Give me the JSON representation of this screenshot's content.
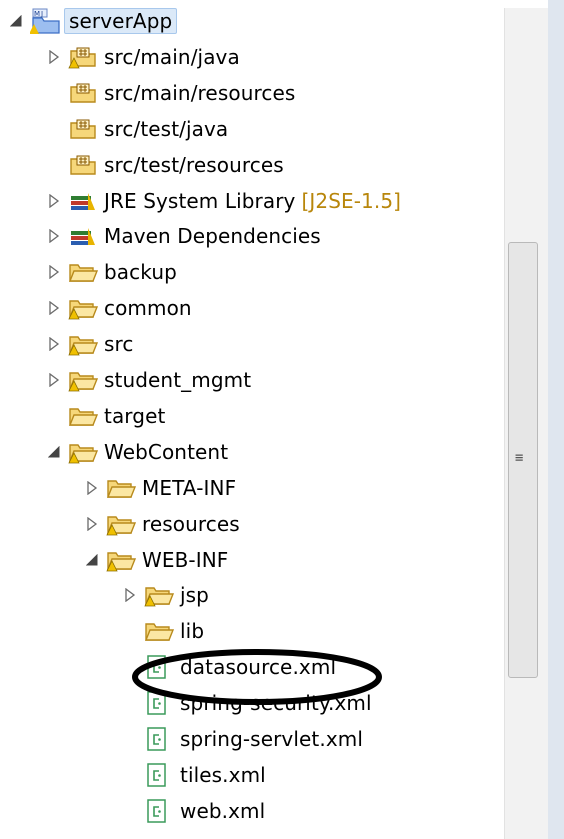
{
  "tree": {
    "rows": [
      {
        "label": "serverApp",
        "indent": 0,
        "arrow": "expanded",
        "icon": "project-icon",
        "selected": true
      },
      {
        "label": "src/main/java",
        "indent": 1,
        "arrow": "collapsed",
        "icon": "source-folder-warning-icon"
      },
      {
        "label": "src/main/resources",
        "indent": 1,
        "arrow": "none",
        "icon": "source-folder-icon"
      },
      {
        "label": "src/test/java",
        "indent": 1,
        "arrow": "none",
        "icon": "source-folder-icon"
      },
      {
        "label": "src/test/resources",
        "indent": 1,
        "arrow": "none",
        "icon": "source-folder-icon"
      },
      {
        "label": "JRE System Library",
        "decoration": "[J2SE-1.5]",
        "indent": 1,
        "arrow": "collapsed",
        "icon": "library-icon"
      },
      {
        "label": "Maven Dependencies",
        "indent": 1,
        "arrow": "collapsed",
        "icon": "library-icon"
      },
      {
        "label": "backup",
        "indent": 1,
        "arrow": "collapsed",
        "icon": "folder-icon"
      },
      {
        "label": "common",
        "indent": 1,
        "arrow": "collapsed",
        "icon": "folder-warning-icon"
      },
      {
        "label": "src",
        "indent": 1,
        "arrow": "collapsed",
        "icon": "folder-warning-icon"
      },
      {
        "label": "student_mgmt",
        "indent": 1,
        "arrow": "collapsed",
        "icon": "folder-warning-icon"
      },
      {
        "label": "target",
        "indent": 1,
        "arrow": "none",
        "icon": "folder-icon"
      },
      {
        "label": "WebContent",
        "indent": 1,
        "arrow": "expanded",
        "icon": "folder-warning-icon"
      },
      {
        "label": "META-INF",
        "indent": 2,
        "arrow": "collapsed",
        "icon": "folder-icon"
      },
      {
        "label": "resources",
        "indent": 2,
        "arrow": "collapsed",
        "icon": "folder-warning-icon"
      },
      {
        "label": "WEB-INF",
        "indent": 2,
        "arrow": "expanded",
        "icon": "folder-warning-icon"
      },
      {
        "label": "jsp",
        "indent": 3,
        "arrow": "collapsed",
        "icon": "folder-warning-icon"
      },
      {
        "label": "lib",
        "indent": 3,
        "arrow": "none",
        "icon": "folder-icon"
      },
      {
        "label": "datasource.xml",
        "indent": 3,
        "arrow": "none",
        "icon": "xml-file-icon"
      },
      {
        "label": "spring-security.xml",
        "indent": 3,
        "arrow": "none",
        "icon": "xml-file-icon"
      },
      {
        "label": "spring-servlet.xml",
        "indent": 3,
        "arrow": "none",
        "icon": "xml-file-icon"
      },
      {
        "label": "tiles.xml",
        "indent": 3,
        "arrow": "none",
        "icon": "xml-file-icon"
      },
      {
        "label": "web.xml",
        "indent": 3,
        "arrow": "none",
        "icon": "xml-file-icon"
      }
    ]
  },
  "colors": {
    "folder_fill": "#f6d77a",
    "folder_stroke": "#b88a1c",
    "warning": "#f0c000",
    "xml_green": "#3a9a5a",
    "arrow": "#6b6b6b",
    "highlight_ellipse": "#000000"
  }
}
